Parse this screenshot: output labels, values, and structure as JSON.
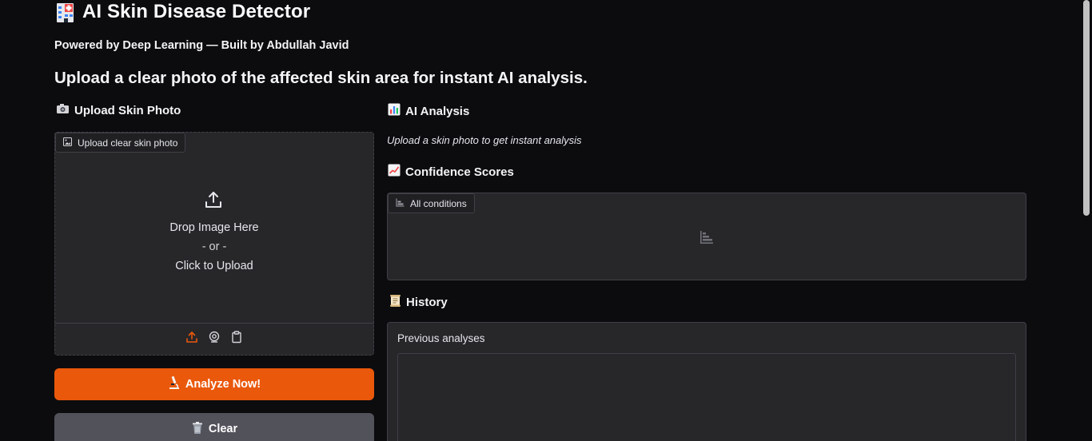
{
  "header": {
    "title": "AI Skin Disease Detector",
    "title_icon": "hospital-icon",
    "subtitle": "Powered by Deep Learning — Built by Abdullah Javid",
    "lead": "Upload a clear photo of the affected skin area for instant AI analysis."
  },
  "upload_section": {
    "heading": "Upload Skin Photo",
    "heading_icon": "camera-icon",
    "chip_label": "Upload clear skin photo",
    "drop_text": "Drop Image Here",
    "or_text": "- or -",
    "click_text": "Click to Upload",
    "sources": [
      "upload-icon",
      "webcam-icon",
      "clipboard-icon"
    ]
  },
  "buttons": {
    "analyze": "Analyze Now!",
    "clear": "Clear"
  },
  "analysis_section": {
    "heading": "AI Analysis",
    "heading_icon": "bar-chart-icon",
    "info": "Upload a skin photo to get instant analysis"
  },
  "confidence_section": {
    "heading": "Confidence Scores",
    "heading_icon": "line-chart-icon",
    "chip_label": "All conditions"
  },
  "history_section": {
    "heading": "History",
    "heading_icon": "scroll-icon",
    "label": "Previous analyses"
  },
  "colors": {
    "accent": "#ea580c",
    "background": "#0c0c0f",
    "panel": "#27272a",
    "secondary_button": "#52525b"
  }
}
